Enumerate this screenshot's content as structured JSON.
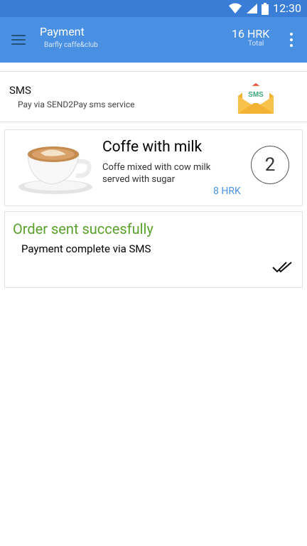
{
  "status_bar": {
    "time": "12:30"
  },
  "app_bar": {
    "title": "Payment",
    "subtitle": "Barfly caffe&club",
    "total_amount": "16 HRK",
    "total_label": "Total"
  },
  "payment_method": {
    "title": "SMS",
    "description": "Pay via SEND2Pay sms service",
    "icon_text": "SMS"
  },
  "order_item": {
    "name": "Coffe with milk",
    "description": "Coffe mixed with cow milk served with sugar",
    "price": "8 HRK",
    "quantity": "2"
  },
  "order_status": {
    "title": "Order sent succesfully",
    "message": "Payment complete via SMS",
    "title_color": "#5aa02c"
  },
  "colors": {
    "app_bar": "#4a90e2",
    "status_bar": "#3a7dd6",
    "accent": "#4a90e2"
  }
}
